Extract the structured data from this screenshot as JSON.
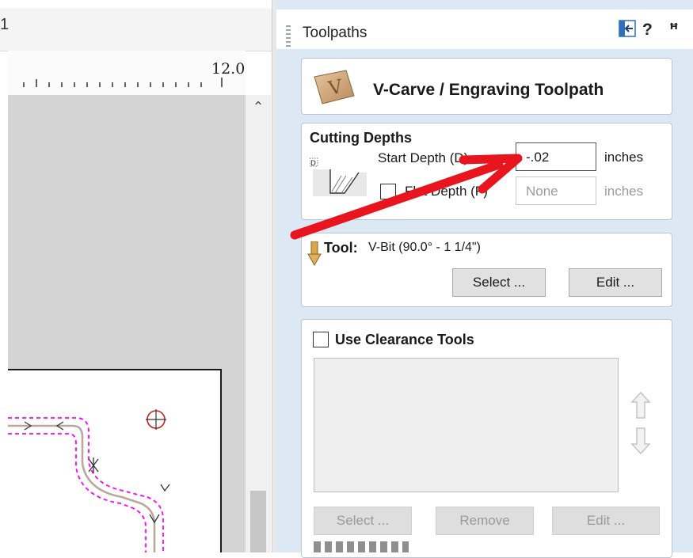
{
  "panel": {
    "title": "Toolpaths",
    "header_icons": [
      "panel-layout-icon",
      "help-icon",
      "pin-icon"
    ],
    "help_glyph": "?",
    "pin_glyph": "ꟸ"
  },
  "toolpath_header": {
    "title": "V-Carve / Engraving Toolpath",
    "badge_letter": "V"
  },
  "cutting_depths": {
    "title": "Cutting Depths",
    "start_depth_label": "Start Depth (D)",
    "start_depth_value": "-.02",
    "start_depth_unit": "inches",
    "flat_depth_label": "Flat Depth (F)",
    "flat_depth_value": "None",
    "flat_depth_unit": "inches",
    "flat_depth_checked": false
  },
  "tool": {
    "label": "Tool:",
    "value": "V-Bit (90.0° - 1 1/4\")",
    "select_label": "Select ...",
    "edit_label": "Edit ..."
  },
  "clearance": {
    "label": "Use Clearance Tools",
    "checked": false,
    "select_label": "Select ...",
    "remove_label": "Remove",
    "edit_label": "Edit ..."
  },
  "ruler": {
    "label": "12.0"
  },
  "colors": {
    "panel_bg": "#dce8f4",
    "annotation_arrow": "#e8141e",
    "vector_preview": "#ff00ff",
    "toolpath_line": "#b8a8a0"
  }
}
